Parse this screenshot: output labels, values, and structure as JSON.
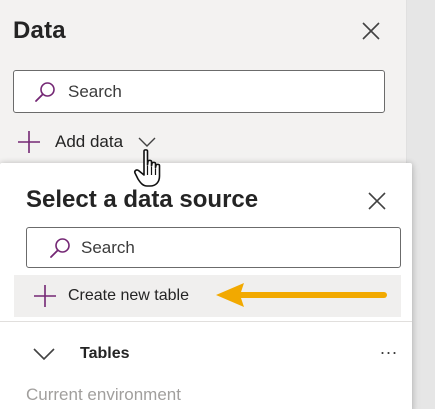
{
  "panel": {
    "title": "Data",
    "search_placeholder": "Search",
    "add_data_label": "Add data",
    "icons": [
      "close-icon",
      "search-icon",
      "plus-icon",
      "chevron-down-icon"
    ]
  },
  "popup": {
    "title": "Select a data source",
    "search_placeholder": "Search",
    "create_table_label": "Create new table",
    "section_label": "Tables",
    "more_label": "...",
    "environment_label": "Current environment"
  },
  "colors": {
    "accent_icon": "#742774",
    "arrow": "#f2a900",
    "panel_bg": "#f3f2f1",
    "highlight_bg": "#f0efee",
    "muted_text": "#a19f9d"
  }
}
